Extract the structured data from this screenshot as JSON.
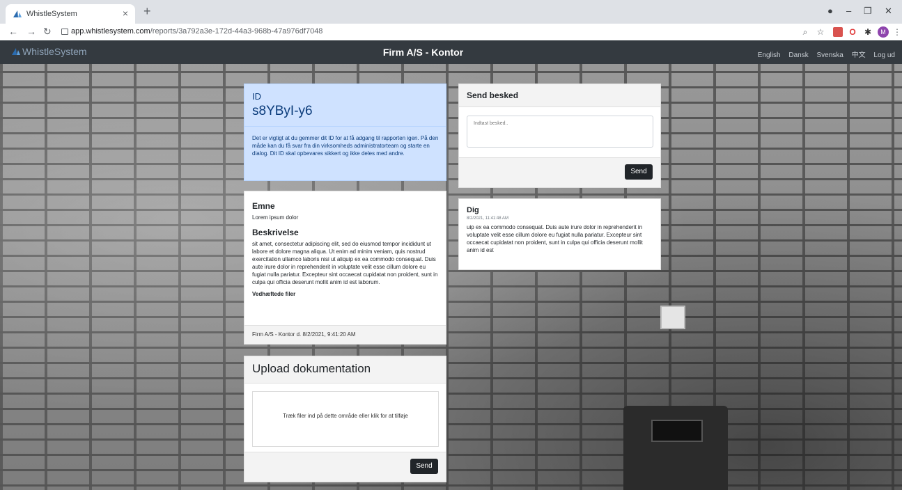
{
  "browser": {
    "tab_title": "WhistleSystem",
    "tab_close": "×",
    "new_tab": "+",
    "url_domain": "app.whistlesystem.com",
    "url_path": "/reports/3a792a3e-172d-44a3-968b-47a976df7048",
    "avatar_letter": "M"
  },
  "navbar": {
    "brand": "WhistleSystem",
    "title": "Firm A/S - Kontor",
    "links": [
      "English",
      "Dansk",
      "Svenska",
      "中文",
      "Log ud"
    ]
  },
  "id_card": {
    "label": "ID",
    "value": "s8YByI-y6",
    "text": "Det er vigtigt at du gemmer dit ID for at få adgang til rapporten igen. På den måde kan du få svar fra din virksomheds administratorteam og starte en dialog. Dit ID skal opbevares sikkert og ikke deles med andre."
  },
  "report": {
    "subject_heading": "Emne",
    "subject": "Lorem ipsum dolor",
    "description_heading": "Beskrivelse",
    "description": "sit amet, consectetur adipiscing elit, sed do eiusmod tempor incididunt ut labore et dolore magna aliqua. Ut enim ad minim veniam, quis nostrud exercitation ullamco laboris nisi ut aliquip ex ea commodo consequat. Duis aute irure dolor in reprehenderit in voluptate velit esse cillum dolore eu fugiat nulla pariatur. Excepteur sint occaecat cupidatat non proident, sunt in culpa qui officia deserunt mollit anim id est laborum.",
    "attachments_heading": "Vedhæftede filer",
    "footer": "Firm A/S - Kontor d. 8/2/2021, 9:41:20 AM"
  },
  "upload": {
    "title": "Upload dokumentation",
    "dropzone_text": "Træk filer ind på dette område eller klik for at tilføje",
    "send_label": "Send"
  },
  "send_message": {
    "title": "Send besked",
    "placeholder": "Indtast besked..",
    "send_label": "Send"
  },
  "message": {
    "from": "Dig",
    "time": "8/2/2021, 11:41:48 AM",
    "text": "uip ex ea commodo consequat. Duis aute irure dolor in reprehenderit in voluptate velit esse cillum dolore eu fugiat nulla pariatur. Excepteur sint occaecat cupidatat non proident, sunt in culpa qui officia deserunt mollit anim id est"
  },
  "colors": {
    "navbar_bg": "#343a40",
    "id_card_bg": "#cfe2ff",
    "id_text": "#0a3b7a",
    "button_bg": "#212529"
  }
}
